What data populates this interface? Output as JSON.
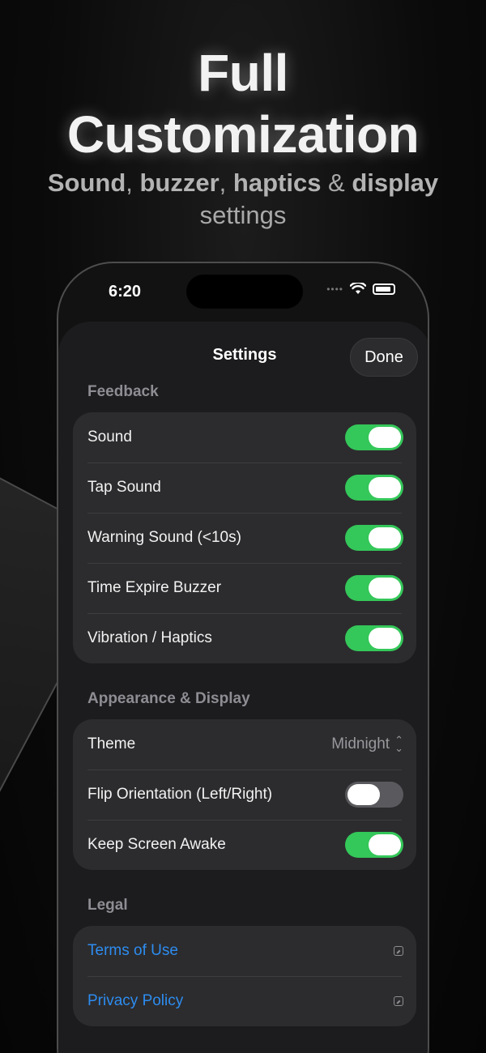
{
  "promo": {
    "headline_line1": "Full",
    "headline_line2": "Customization",
    "sub_bold1": "Sound",
    "sub_sep1": ", ",
    "sub_bold2": "buzzer",
    "sub_sep2": ", ",
    "sub_bold3": "haptics",
    "sub_sep3": " & ",
    "sub_bold4": "display",
    "sub_line2": "settings"
  },
  "status_bar": {
    "time": "6:20"
  },
  "sheet": {
    "title": "Settings",
    "done_label": "Done"
  },
  "sections": {
    "feedback": {
      "label": "Feedback",
      "rows": [
        {
          "label": "Sound",
          "toggle": "on"
        },
        {
          "label": "Tap Sound",
          "toggle": "on"
        },
        {
          "label": "Warning Sound (<10s)",
          "toggle": "on"
        },
        {
          "label": "Time Expire Buzzer",
          "toggle": "on"
        },
        {
          "label": "Vibration / Haptics",
          "toggle": "on"
        }
      ]
    },
    "appearance": {
      "label": "Appearance & Display",
      "theme_label": "Theme",
      "theme_value": "Midnight",
      "flip_label": "Flip Orientation (Left/Right)",
      "flip_toggle": "off",
      "awake_label": "Keep Screen Awake",
      "awake_toggle": "on"
    },
    "legal": {
      "label": "Legal",
      "terms": "Terms of Use",
      "privacy": "Privacy Policy"
    }
  },
  "colors": {
    "toggle_on": "#34c759",
    "link": "#2d8cf0",
    "background": "#0b0b0b"
  }
}
